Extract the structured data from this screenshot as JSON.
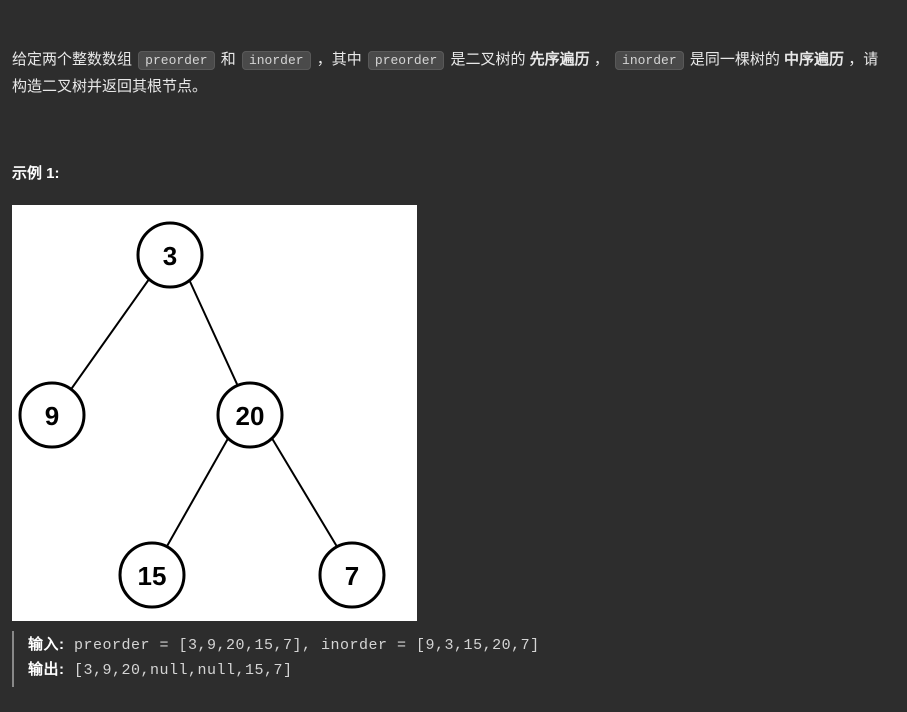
{
  "description": {
    "part1": "给定两个整数数组 ",
    "code1": "preorder",
    "part2": " 和 ",
    "code2": "inorder",
    "part3": " ，其中 ",
    "code3": "preorder",
    "part4": " 是二叉树的",
    "bold1": "先序遍历",
    "part5": "， ",
    "code4": "inorder",
    "part6": " 是同一棵树的",
    "bold2": "中序遍历",
    "part7": "，请构造二叉树并返回其根节点。"
  },
  "example": {
    "title": "示例 1:",
    "input_label": "输入:",
    "input_value": " preorder = [3,9,20,15,7], inorder = [9,3,15,20,7]",
    "output_label": "输出:",
    "output_value": " [3,9,20,null,null,15,7]"
  },
  "tree": {
    "nodes": {
      "root": "3",
      "left": "9",
      "right": "20",
      "right_left": "15",
      "right_right": "7"
    }
  }
}
